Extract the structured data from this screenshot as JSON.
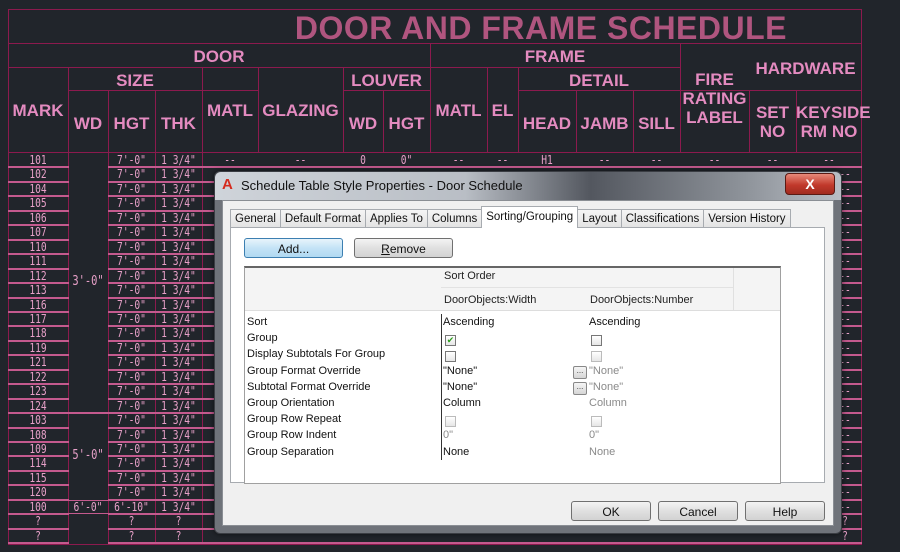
{
  "schedule": {
    "title": "DOOR AND FRAME SCHEDULE",
    "headers": {
      "door": "DOOR",
      "frame": "FRAME",
      "mark": "MARK",
      "size": "SIZE",
      "wd": "WD",
      "hgt": "HGT",
      "thk": "THK",
      "matl": "MATL",
      "glazing": "GLAZING",
      "louver": "LOUVER",
      "louver_wd": "WD",
      "louver_hgt": "HGT",
      "frame_matl": "MATL",
      "el": "EL",
      "detail": "DETAIL",
      "head": "HEAD",
      "jamb": "JAMB",
      "sill": "SILL",
      "fire_rating_label": "FIRE RATING LABEL",
      "hardware": "HARDWARE",
      "set_no": "SET NO",
      "keyside_rm_no": "KEYSIDE RM NO"
    },
    "first_row": {
      "mark": "101",
      "hgt": "7'-0\"",
      "thk": "1 3/4\"",
      "matl": "--",
      "glazing": "--",
      "louver_wd": "0",
      "louver_hgt": "0\"",
      "frame_matl": "--",
      "el": "--",
      "head": "H1",
      "jamb": "--",
      "sill": "--",
      "fire": "--",
      "set_no": "--",
      "keyside": "--"
    },
    "marks": [
      "101",
      "102",
      "104",
      "105",
      "106",
      "107",
      "110",
      "111",
      "112",
      "113",
      "116",
      "117",
      "118",
      "119",
      "121",
      "122",
      "123",
      "124",
      "103",
      "108",
      "109",
      "114",
      "115",
      "120",
      "100",
      "?",
      "?"
    ],
    "heights": [
      "7'-0\"",
      "7'-0\"",
      "7'-0\"",
      "7'-0\"",
      "7'-0\"",
      "7'-0\"",
      "7'-0\"",
      "7'-0\"",
      "7'-0\"",
      "7'-0\"",
      "7'-0\"",
      "7'-0\"",
      "7'-0\"",
      "7'-0\"",
      "7'-0\"",
      "7'-0\"",
      "7'-0\"",
      "7'-0\"",
      "7'-0\"",
      "7'-0\"",
      "7'-0\"",
      "7'-0\"",
      "7'-0\"",
      "7'-0\"",
      "6'-10\"",
      "?",
      "?"
    ],
    "thicknesses": [
      "1 3/4\"",
      "1 3/4\"",
      "1 3/4\"",
      "1 3/4\"",
      "1 3/4\"",
      "1 3/4\"",
      "1 3/4\"",
      "1 3/4\"",
      "1 3/4\"",
      "1 3/4\"",
      "1 3/4\"",
      "1 3/4\"",
      "1 3/4\"",
      "1 3/4\"",
      "1 3/4\"",
      "1 3/4\"",
      "1 3/4\"",
      "1 3/4\"",
      "1 3/4\"",
      "1 3/4\"",
      "1 3/4\"",
      "1 3/4\"",
      "1 3/4\"",
      "1 3/4\"",
      "1 3/4\"",
      "?",
      "?"
    ],
    "width_groups": [
      "3'-0\"",
      "5'-0\"",
      "6'-0\""
    ],
    "keyside_column": [
      "--",
      "--",
      "--",
      "--",
      "--",
      "--",
      "--",
      "--",
      "--",
      "--",
      "--",
      "--",
      "--",
      "--",
      "--",
      "--",
      "--",
      "--",
      "--",
      "--",
      "--",
      "--",
      "--",
      "--",
      "--",
      "?",
      "?"
    ],
    "last_row_partial": [
      "?",
      "?",
      "?",
      "?",
      "--",
      "--",
      "--"
    ]
  },
  "dialog": {
    "title": "Schedule Table Style Properties - Door Schedule",
    "close_label": "X",
    "app_icon": "A",
    "tabs": [
      {
        "label": "General"
      },
      {
        "label": "Default Format"
      },
      {
        "label": "Applies To"
      },
      {
        "label": "Columns"
      },
      {
        "label": "Sorting/Grouping",
        "active": true
      },
      {
        "label": "Layout"
      },
      {
        "label": "Classifications"
      },
      {
        "label": "Version History"
      }
    ],
    "add_label": "Add...",
    "remove_label": "Remove",
    "grid": {
      "group_header": "Sort Order",
      "columns": [
        "DoorObjects:Width",
        "DoorObjects:Number"
      ],
      "rows": [
        {
          "label": "Sort",
          "col1": "Ascending",
          "col2": "Ascending"
        },
        {
          "label": "Group",
          "col1_checked": true,
          "col2_checked": false
        },
        {
          "label": "Display Subtotals For Group",
          "col1_checked": false,
          "col2_checked": false
        },
        {
          "label": "Group Format Override",
          "col1": "\"None\"",
          "col2": "\"None\""
        },
        {
          "label": "Subtotal Format Override",
          "col1": "\"None\"",
          "col2": "\"None\""
        },
        {
          "label": "Group Orientation",
          "col1": "Column",
          "col2": "Column"
        },
        {
          "label": "Group Row Repeat",
          "col1_checked": false,
          "col2_checked": false
        },
        {
          "label": "Group Row Indent",
          "col1": "0\"",
          "col2": "0\""
        },
        {
          "label": "Group Separation",
          "col1": "None",
          "col2": "None"
        }
      ],
      "ellipsis": "..."
    },
    "ok_label": "OK",
    "cancel_label": "Cancel",
    "help_label": "Help",
    "check_mark": "✔"
  }
}
